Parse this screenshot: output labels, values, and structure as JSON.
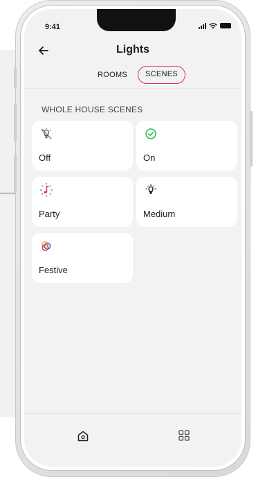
{
  "status_bar": {
    "time": "9:41"
  },
  "header": {
    "title": "Lights",
    "back_icon": "arrow-left-icon"
  },
  "tabs": [
    {
      "label": "ROOMS",
      "selected": false
    },
    {
      "label": "SCENES",
      "selected": true
    }
  ],
  "colors": {
    "accent": "#d8335e",
    "on_green": "#2dbb4e",
    "festive_blue": "#3a6ee8",
    "festive_yellow": "#f2b11e"
  },
  "section": {
    "title": "WHOLE HOUSE SCENES"
  },
  "scenes": [
    {
      "label": "Off",
      "icon": "bulb-off-icon"
    },
    {
      "label": "On",
      "icon": "check-circle-icon"
    },
    {
      "label": "Party",
      "icon": "music-note-icon"
    },
    {
      "label": "Medium",
      "icon": "bulb-glow-icon"
    },
    {
      "label": "Festive",
      "icon": "interlocking-rings-icon"
    }
  ],
  "bottom_nav": [
    {
      "icon": "home-icon"
    },
    {
      "icon": "grid-icon"
    }
  ]
}
